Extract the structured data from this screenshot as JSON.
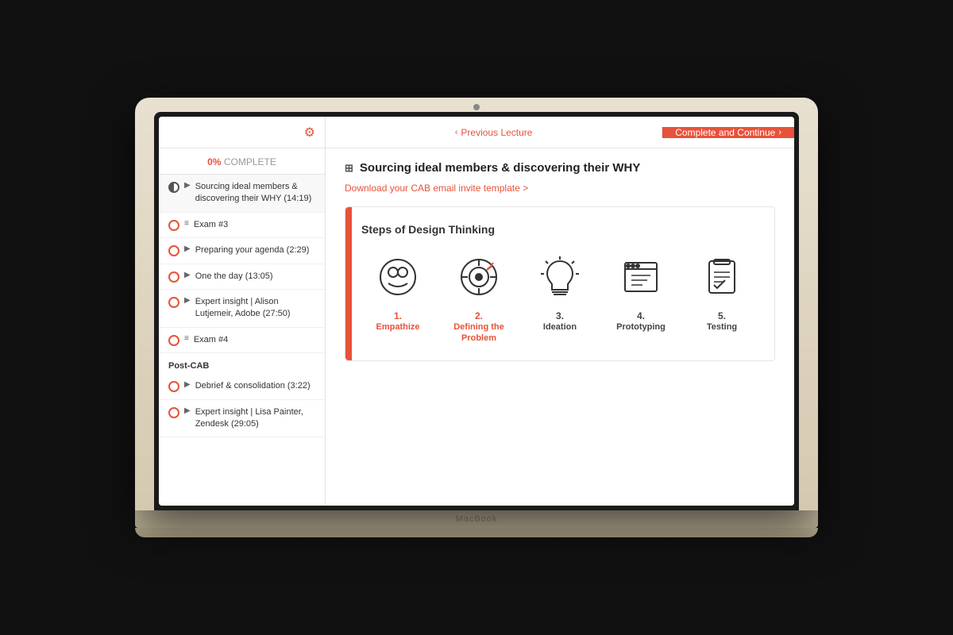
{
  "header": {
    "prev_label": "Previous Lecture",
    "complete_label": "Complete and Continue"
  },
  "sidebar": {
    "progress_pct": "0%",
    "progress_label": "COMPLETE",
    "items": [
      {
        "id": "sourcing",
        "icon": "▶",
        "text": "Sourcing ideal members & discovering their WHY (14:19)",
        "status": "active"
      },
      {
        "id": "exam3",
        "icon": "≡",
        "text": "Exam #3",
        "status": "incomplete"
      },
      {
        "id": "preparing",
        "icon": "▶",
        "text": "Preparing your agenda (2:29)",
        "status": "incomplete"
      },
      {
        "id": "oneday",
        "icon": "▶",
        "text": "One the day (13:05)",
        "status": "incomplete"
      },
      {
        "id": "expert1",
        "icon": "▶",
        "text": "Expert insight | Alison Lutjemeir, Adobe (27:50)",
        "status": "incomplete"
      },
      {
        "id": "exam4",
        "icon": "≡",
        "text": "Exam #4",
        "status": "incomplete"
      }
    ],
    "sections": [
      {
        "id": "post-cab",
        "label": "Post-CAB",
        "items": [
          {
            "id": "debrief",
            "icon": "▶",
            "text": "Debrief & consolidation (3:22)"
          },
          {
            "id": "expert2",
            "icon": "▶",
            "text": "Expert insight | Lisa Painter, Zendesk (29:05)"
          }
        ]
      }
    ]
  },
  "content": {
    "title": "Sourcing ideal members & discovering their WHY",
    "download_link": "Download your CAB email invite template >",
    "section_title": "Steps of Design Thinking",
    "steps": [
      {
        "number": "1.",
        "label": "Empathize",
        "highlight": true
      },
      {
        "number": "2.",
        "label": "Defining the Problem",
        "highlight": true
      },
      {
        "number": "3.",
        "label": "Ideation",
        "highlight": false
      },
      {
        "number": "4.",
        "label": "Prototyping",
        "highlight": false
      },
      {
        "number": "5.",
        "label": "Testing",
        "highlight": false
      }
    ]
  },
  "brand": "MacBook",
  "colors": {
    "accent": "#e8523a",
    "text_dark": "#333",
    "text_light": "#999"
  }
}
